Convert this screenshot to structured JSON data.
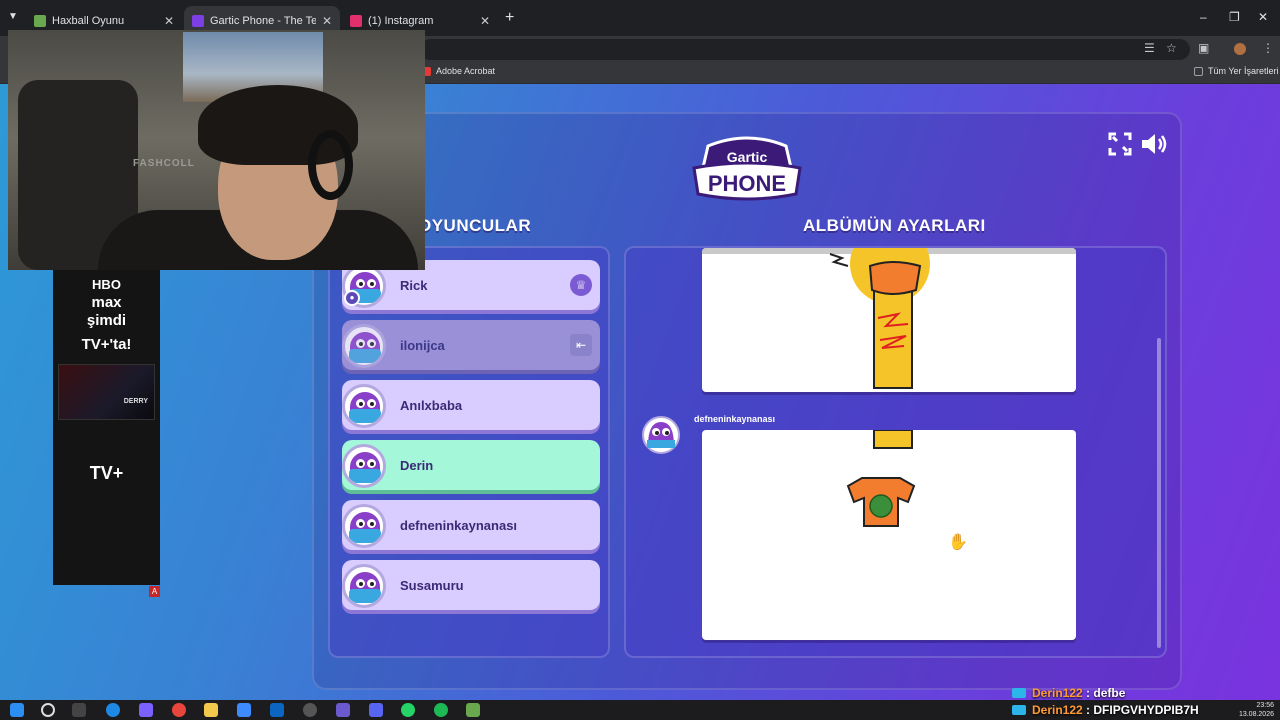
{
  "browser": {
    "tabs": [
      {
        "title": "Haxball Oyunu",
        "favicon_color": "#6aa84f",
        "active": false
      },
      {
        "title": "Gartic Phone - The Telephone G",
        "favicon_color": "#7b3fe4",
        "active": true
      },
      {
        "title": "(1) Instagram",
        "favicon_color": "#e1306c",
        "active": false
      }
    ],
    "new_tab_icon": "plus-icon",
    "bookmarks": [
      {
        "label": "Adobe Acrobat",
        "icon": "acrobat-icon",
        "color": "#e53935"
      },
      {
        "label": "Tüm Yer İşaretleri",
        "icon": "folder-icon",
        "color": "#9aa0a6"
      }
    ]
  },
  "game": {
    "players_title": "OYUNCULAR",
    "album_title": "ALBÜMÜN AYARLARI",
    "logo_top": "Gartic",
    "logo_bottom": "PHONE",
    "players": [
      {
        "name": "Rick",
        "state": "host",
        "badge_icon": "crown-icon"
      },
      {
        "name": "ilonijca",
        "state": "away",
        "badge_icon": "exit-icon"
      },
      {
        "name": "Anılxbaba",
        "state": "normal"
      },
      {
        "name": "Derin",
        "state": "current"
      },
      {
        "name": "defneninkaynanası",
        "state": "normal"
      },
      {
        "name": "Susamuru",
        "state": "normal"
      }
    ],
    "album": {
      "entry_author": "defneninkaynanası"
    }
  },
  "ad": {
    "line1": "HBO",
    "line2": "max",
    "line3": "şimdi",
    "line4": "TV+'ta!",
    "thumb_caption": "DERRY",
    "footer_logo": "TV+"
  },
  "webcam": {
    "chair_label": "FASHCOLL"
  },
  "chat": [
    {
      "user": "Derin122",
      "message": "defbe"
    },
    {
      "user": "Derin122",
      "message": "DFIPGVHYDPIB7H"
    }
  ],
  "taskbar": {
    "time": "23:56",
    "date": "13.08.2026"
  }
}
